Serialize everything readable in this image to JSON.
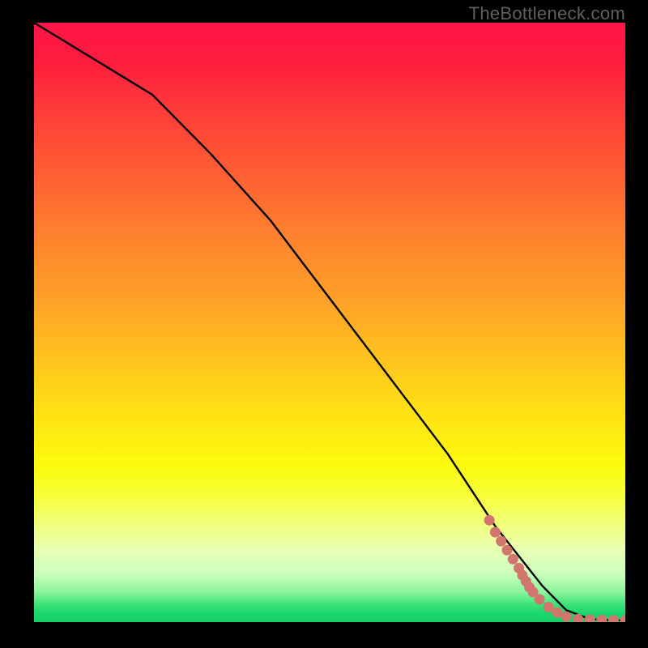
{
  "attribution": "TheBottleneck.com",
  "colors": {
    "frame": "#000000",
    "gradient_top": "#ff1548",
    "gradient_mid": "#ffe413",
    "gradient_bottom": "#13cf65",
    "curve": "#000000",
    "marker": "#d1766f"
  },
  "chart_data": {
    "type": "line",
    "title": "",
    "xlabel": "",
    "ylabel": "",
    "xlim": [
      0,
      100
    ],
    "ylim": [
      0,
      100
    ],
    "series": [
      {
        "name": "curve",
        "x": [
          0,
          10,
          20,
          30,
          40,
          50,
          60,
          70,
          78,
          82,
          86,
          90,
          94,
          98,
          100
        ],
        "y": [
          100,
          94,
          88,
          78,
          67,
          54,
          41,
          28,
          16,
          11,
          6,
          2,
          0.5,
          0.3,
          0.3
        ]
      }
    ],
    "markers": {
      "name": "points",
      "x": [
        77,
        78,
        79,
        80,
        81,
        82,
        82.6,
        83.2,
        83.8,
        84.4,
        85.5,
        87,
        88.5,
        90,
        92,
        94,
        96,
        98,
        100
      ],
      "y": [
        17,
        15,
        13.5,
        12,
        10.5,
        9,
        7.8,
        6.8,
        5.8,
        5,
        3.8,
        2.5,
        1.6,
        0.9,
        0.5,
        0.4,
        0.35,
        0.3,
        0.3
      ]
    }
  }
}
